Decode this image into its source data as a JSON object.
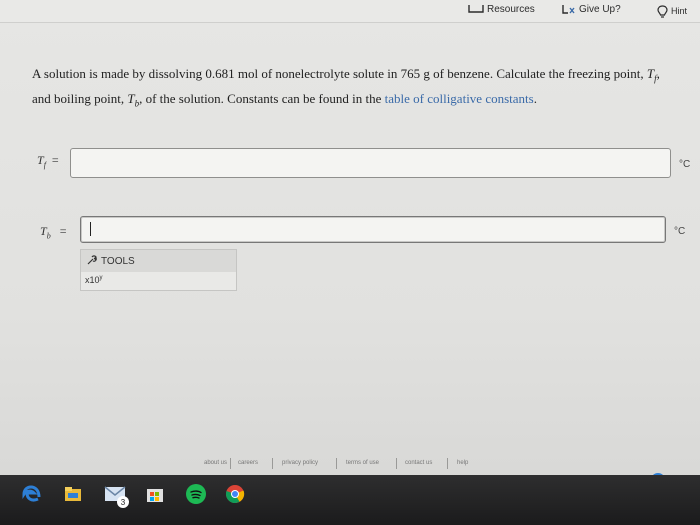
{
  "topbar": {
    "resources_label": "Resources",
    "giveup_label": "Give Up?",
    "hint_label": "Hint"
  },
  "question": {
    "part1": "A solution is made by dissolving 0.681 mol of nonelectrolyte solute in 765 g of benzene. Calculate the freezing point, ",
    "tf_symbol": "T",
    "tf_sub": "f",
    "part2": ", and boiling point, ",
    "tb_symbol": "T",
    "tb_sub": "b",
    "part3": ", of the solution. Constants can be found in the ",
    "link_text": "table of colligative constants",
    "part4": "."
  },
  "fields": {
    "tf_label": "T",
    "tf_label_sub": "f",
    "tf_eq": "=",
    "tf_value": "",
    "tf_unit": "°C",
    "tb_label": "T",
    "tb_label_sub": "b",
    "tb_eq": "=",
    "tb_value": "",
    "tb_unit": "°C"
  },
  "tools": {
    "label": "TOOLS",
    "x10_label": "x10",
    "x10_sup": "y"
  },
  "footer": {
    "links": [
      "about us",
      "careers",
      "privacy policy",
      "terms of use",
      "contact us",
      "help"
    ]
  },
  "taskbar": {
    "badge_count": "3"
  },
  "colors": {
    "link": "#3a6aa8",
    "taskbar": "#1f1f20",
    "accent_blue": "#2d7fd6",
    "spotify": "#1db954"
  }
}
